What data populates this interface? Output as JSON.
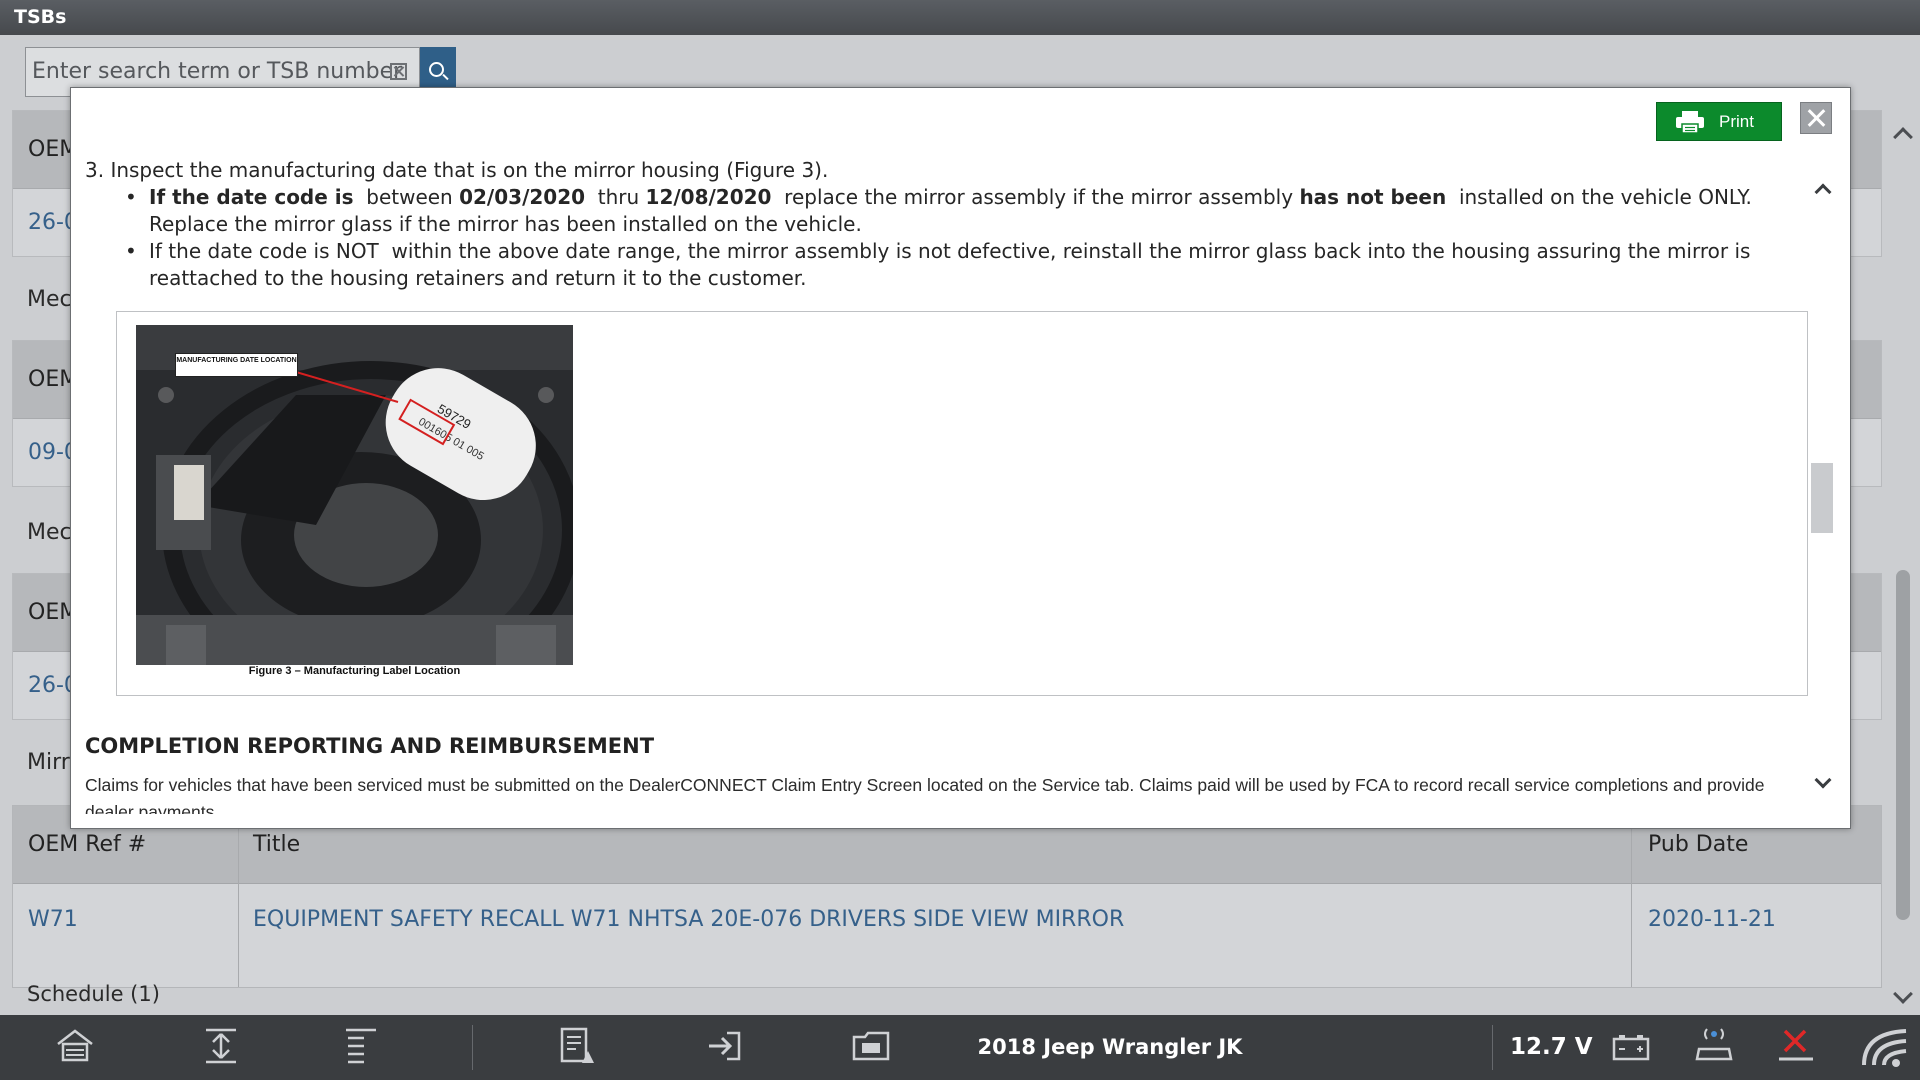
{
  "app": {
    "title": "TSBs"
  },
  "search": {
    "placeholder": "Enter search term or TSB number"
  },
  "background": {
    "card_headers": [
      "OEM",
      "OEM",
      "OEM"
    ],
    "card_refs": [
      "26-0",
      "09-0",
      "26-0"
    ],
    "section_labels": [
      "Mec",
      "Mec",
      "Mirr"
    ],
    "w71_table": {
      "columns": [
        "OEM Ref #",
        "Title",
        "Pub Date"
      ],
      "row": {
        "ref": "W71",
        "title": "EQUIPMENT SAFETY RECALL W71 NHTSA 20E-076 DRIVERS SIDE VIEW MIRROR",
        "date": "2020-11-21"
      }
    },
    "schedule_label": "Schedule (1)"
  },
  "modal": {
    "print_label": "Print",
    "step": "3.  Inspect the manufacturing date that is on the mirror housing (Figure 3).",
    "bullet1": {
      "lead": "If the date code is",
      "between": "  between ",
      "date1": "02/03/2020",
      "thru": "  thru ",
      "date2": "12/08/2020",
      "mid": "  replace the mirror assembly if the mirror assembly ",
      "not_been": "has not been",
      "end": "  installed on the vehicle ONLY.",
      "line2": "Replace the mirror glass if the mirror has been installed on the vehicle."
    },
    "bullet2": {
      "line1": "If the date code is NOT  within the above date range, the mirror assembly is not defective, reinstall the mirror glass back into the housing assuring the mirror is",
      "line2": "reattached to the housing retainers and return it to the customer."
    },
    "figure": {
      "callout": "MANUFACTURING DATE LOCATION",
      "caption": "Figure 3 – Manufacturing Label Location"
    },
    "section_heading": "COMPLETION REPORTING AND REIMBURSEMENT",
    "paragraph": "Claims for vehicles that have been serviced must be submitted on the DealerCONNECT Claim Entry Screen located on the Service tab. Claims paid will be used by FCA to record recall service completions and provide dealer payments."
  },
  "bottombar": {
    "vehicle": "2018 Jeep Wrangler JK",
    "voltage": "12.7 V",
    "icons": [
      "home-icon",
      "expand-all-icon",
      "collapse-all-icon",
      "report-icon",
      "exit-icon",
      "folder-icon",
      "battery-icon",
      "vci-icon",
      "disconnect-icon",
      "wifi-icon"
    ]
  },
  "colors": {
    "print_button": "#0c8a2c",
    "link": "#35608a",
    "search_button": "#2f5f88"
  }
}
